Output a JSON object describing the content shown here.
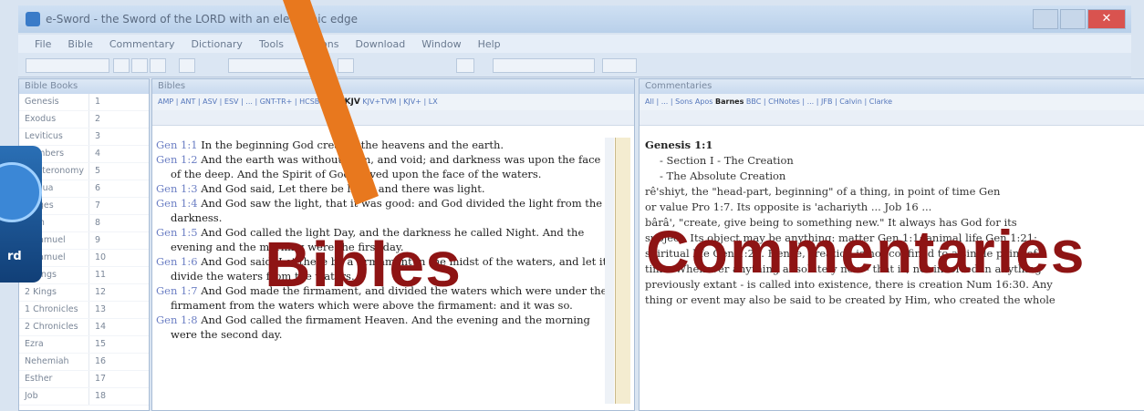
{
  "window": {
    "title": "e-Sword - the Sword of the LORD with an electronic edge",
    "close_label": "✕"
  },
  "menu": [
    "File",
    "Bible",
    "Commentary",
    "Dictionary",
    "Tools",
    "Options",
    "Download",
    "Window",
    "Help"
  ],
  "books_panel": {
    "title": "Bible Books",
    "books": [
      "Genesis",
      "Exodus",
      "Leviticus",
      "Numbers",
      "Deuteronomy",
      "Joshua",
      "Judges",
      "Ruth",
      "1 Samuel",
      "2 Samuel",
      "1 Kings",
      "2 Kings",
      "1 Chronicles",
      "2 Chronicles",
      "Ezra",
      "Nehemiah",
      "Esther",
      "Job"
    ],
    "chapters": [
      "1",
      "2",
      "3",
      "4",
      "5",
      "6",
      "7",
      "8",
      "9",
      "10",
      "11",
      "12",
      "13",
      "14",
      "15",
      "16",
      "17",
      "18"
    ]
  },
  "bible_panel": {
    "title": "Bibles",
    "tabs": "AMP | ANT | ASV | ESV | ... | GNT-TR+ | HCSB | HNT",
    "active_tab": "KJV",
    "tabs_after": "KJV+TVM | KJV+ | LX",
    "verses": [
      {
        "ref": "Gen 1:1",
        "text": "In the beginning God created the heavens and the earth."
      },
      {
        "ref": "Gen 1:2",
        "text": "And the earth was without form, and void; and darkness was upon the face of the deep. And the Spirit of God moved upon the face of the waters."
      },
      {
        "ref": "Gen 1:3",
        "text": "And God said, Let there be light: and there was light."
      },
      {
        "ref": "Gen 1:4",
        "text": "And God saw the light, that it was good: and God divided the light from the darkness."
      },
      {
        "ref": "Gen 1:5",
        "text": "And God called the light Day, and the darkness he called Night. And the evening and the morning were the first day."
      },
      {
        "ref": "Gen 1:6",
        "text": "And God said, Let there be a firmament in the midst of the waters, and let it divide the waters from the waters."
      },
      {
        "ref": "Gen 1:7",
        "text": "And God made the firmament, and divided the waters which were under the firmament from the waters which were above the firmament: and it was so."
      },
      {
        "ref": "Gen 1:8",
        "text": "And God called the firmament Heaven. And the evening and the morning were the second day."
      }
    ],
    "overlay_label": "Bibles"
  },
  "commentary_panel": {
    "title": "Commentaries",
    "tabs_before": "All | ... | Sons Apos",
    "active_tab": "Barnes",
    "tabs_after": "BBC | CHNotes | ... | JFB | Calvin | Clarke",
    "heading": "Genesis 1:1",
    "lines": [
      "- Section I - The Creation",
      "- The Absolute Creation",
      "rê'shiyt, the \"head-part, beginning\" of a thing, in point of time Gen",
      "or value Pro 1:7. Its opposite is 'achariyth ... Job 16 ...",
      "bârâ', \"create, give being to something new.\" It always has God for its",
      "subject. Its object may be anything: matter Gen 1:1; animal life Gen 1:21;",
      "spiritual life Gen 1:27. Hence, creation is not confined to a single point of",
      "time. Whenever anything absolutely new - that is, not involved in anything",
      "previously extant - is called into existence, there is creation Num 16:30. Any",
      "thing or event may also be said to be created by Him, who created the whole"
    ],
    "overlay_label": "Commentaries"
  },
  "logo": {
    "text": "rd"
  },
  "colors": {
    "overlay": "#8e1414",
    "arrow": "#e8781e",
    "link": "#6c7fc4"
  }
}
